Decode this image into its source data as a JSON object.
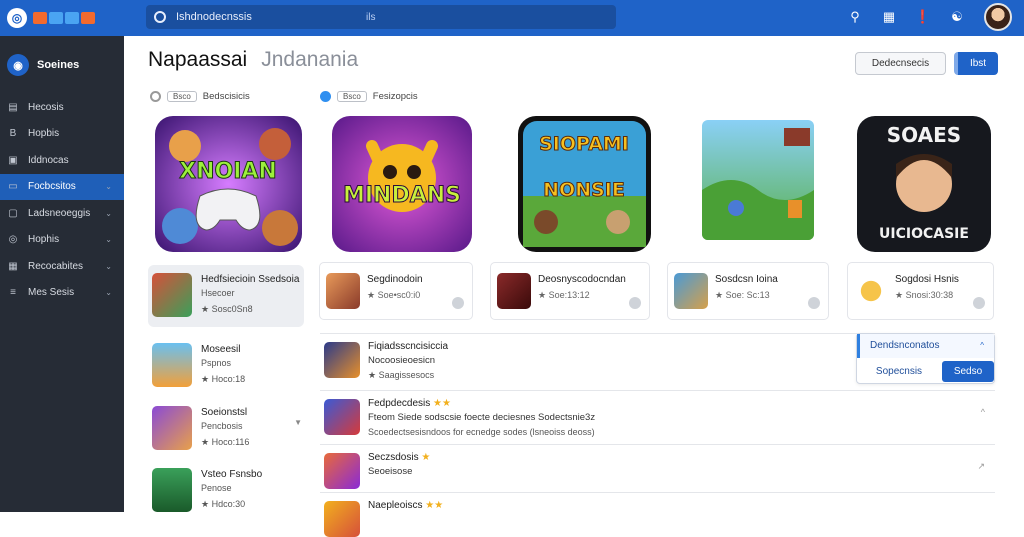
{
  "topbar": {
    "search_text": "Ishdnodecnssis",
    "search_aux": "ils",
    "brand_colors": [
      "#f26a2e",
      "#4aa4f2",
      "#4aa4f2",
      "#f26a2e"
    ],
    "icons": [
      "notification-icon",
      "calendar-icon",
      "chat-icon",
      "users-icon"
    ]
  },
  "sidebar": {
    "title": "Soeines",
    "items": [
      {
        "label": "Hecosis",
        "icon": "home-icon",
        "chevron": false,
        "active": false
      },
      {
        "label": "Hopbis",
        "icon": "bookmark-icon",
        "chevron": false,
        "active": false
      },
      {
        "label": "Iddnocas",
        "icon": "library-icon",
        "chevron": false,
        "active": false
      },
      {
        "label": "Focbcsitos",
        "icon": "folder-icon",
        "chevron": true,
        "active": true
      },
      {
        "label": "Ladsneoeggis",
        "icon": "tag-icon",
        "chevron": true,
        "active": false
      },
      {
        "label": "Hophis",
        "icon": "globe-icon",
        "chevron": true,
        "active": false
      },
      {
        "label": "Recocabites",
        "icon": "grid-icon",
        "chevron": true,
        "active": false
      },
      {
        "label": "Mes Sesis",
        "icon": "list-icon",
        "chevron": true,
        "active": false
      }
    ]
  },
  "header": {
    "title": "Napaassai",
    "subtitle": "Jndanania",
    "outline_button": "Dedecnsecis",
    "primary_button": "Ibst"
  },
  "filters": [
    {
      "pill": "Bsco",
      "label": "Bedscisicis"
    },
    {
      "pill": "Bsco",
      "label": "Fesizopcis"
    }
  ],
  "featured": [
    {
      "art_text": "XNOIAN",
      "theme": "purple"
    },
    {
      "art_text": "MINDANS",
      "theme": "magenta"
    },
    {
      "art_text_top": "SIOPAMI",
      "art_text_bottom": "NONSIE",
      "theme": "green"
    },
    {
      "art_text": "",
      "theme": "landscape"
    },
    {
      "art_text_top": "SOAES",
      "art_text_bottom": "UICIOCASIE",
      "theme": "dark"
    }
  ],
  "cards": [
    {
      "name": "Segdinodoin",
      "meta": "★ Soe•sc0:i0"
    },
    {
      "name": "Deosnyscodocndan",
      "meta": "★ Soe:13:12"
    },
    {
      "name": "Sosdcsn Ioina",
      "meta": "★ Soe: Sc:13"
    },
    {
      "name": "Sogdosi Hsnis",
      "meta": "★ Snosi:30:38"
    }
  ],
  "left_list": [
    {
      "name": "Hedfsiecioin Ssedsoia",
      "sub": "Hsecoer",
      "meta": "★ Sosc0Sn8",
      "highlight": true,
      "caret": false
    },
    {
      "name": "Moseesil",
      "sub": "Pspnos",
      "meta": "★ Hoco:18",
      "highlight": false,
      "caret": false
    },
    {
      "name": "Soeionstsl",
      "sub": "Pencbosis",
      "meta": "★ Hoco:116",
      "highlight": false,
      "caret": true
    },
    {
      "name": "Vsteo Fsnsbo",
      "sub": "Penose",
      "meta": "★ Hdco:30",
      "highlight": false,
      "caret": false
    }
  ],
  "rows": [
    {
      "name": "Fiqiadsscncisiccia",
      "sub": "Nocoosieoesicn",
      "meta": "★ Saagissesocs",
      "stars": "",
      "chevron": ""
    },
    {
      "name": "Fedpdecdesis",
      "stars": "★★",
      "sub": "Fteom  Siede sodscsie foecte deciesnes Sodectsnie3z",
      "meta": "Scoedectsesisndoos for ecnedge sodes (lsneoiss deoss)",
      "chevron": "^"
    },
    {
      "name": "Seczsdosis",
      "stars": "★",
      "sub": "Seoeisose",
      "meta": "",
      "chevron": "↗"
    },
    {
      "name": "Naepleoiscs",
      "stars": "★★",
      "sub": "",
      "meta": "",
      "chevron": ""
    }
  ],
  "dropdown": {
    "header": "Dendsnconatos",
    "option": "Sopecnsis",
    "button": "Sedso"
  }
}
